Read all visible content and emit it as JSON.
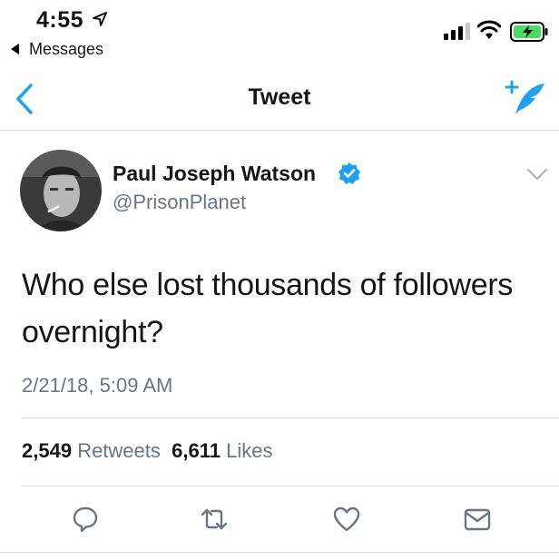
{
  "status_bar": {
    "time": "4:55",
    "back_app_label": "Messages"
  },
  "nav": {
    "title": "Tweet"
  },
  "tweet": {
    "author_name": "Paul Joseph Watson",
    "handle": "@PrisonPlanet",
    "text_line1": "Who else lost thousands of followers",
    "text_line2": "overnight?",
    "timestamp": "2/21/18, 5:09 AM",
    "retweets_count": "2,549",
    "retweets_label": "Retweets",
    "likes_count": "6,611",
    "likes_label": "Likes"
  },
  "colors": {
    "accent": "#1da1f2",
    "secondary_text": "#657786",
    "battery_green": "#4cd964"
  },
  "icons": [
    "location-arrow-icon",
    "back-triangle-icon",
    "signal-icon",
    "wifi-icon",
    "battery-icon",
    "back-chevron-icon",
    "compose-tweet-icon",
    "verified-badge-icon",
    "chevron-down-icon",
    "reply-icon",
    "retweet-icon",
    "like-icon",
    "direct-message-icon"
  ]
}
